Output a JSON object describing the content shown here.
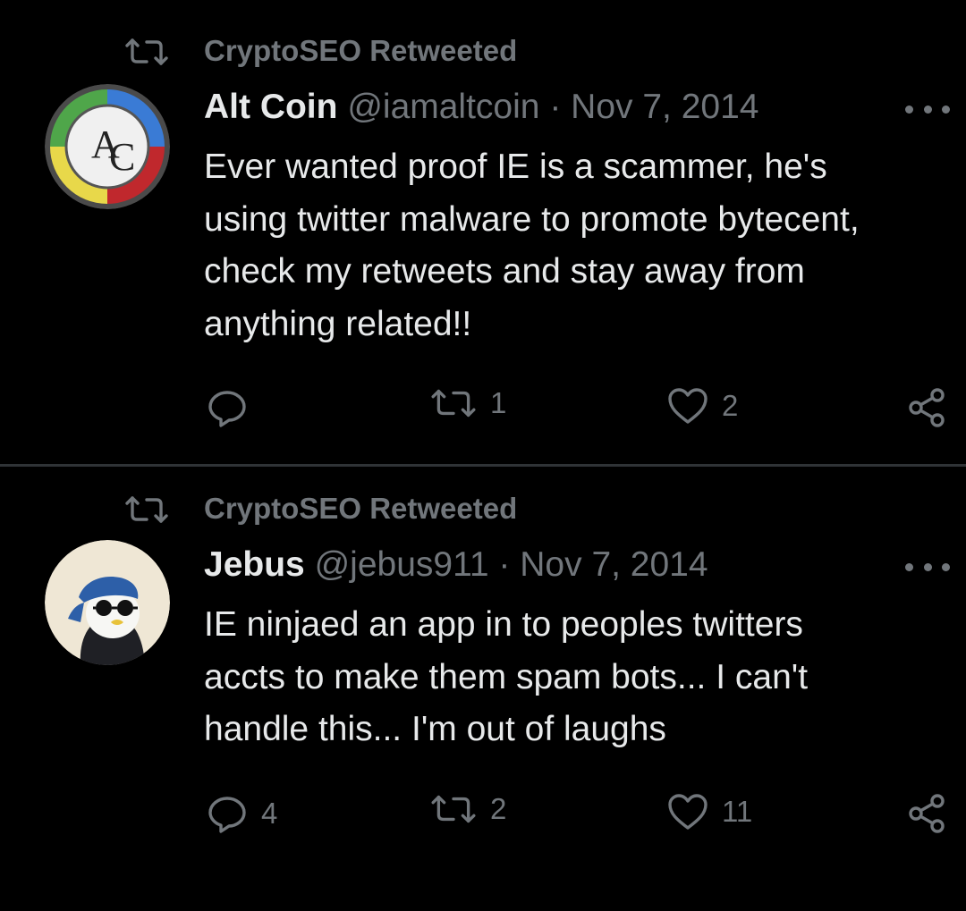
{
  "tweets": [
    {
      "retweeted_by": "CryptoSEO Retweeted",
      "name": "Alt Coin",
      "handle": "@iamaltcoin",
      "separator": "·",
      "date": "Nov 7, 2014",
      "text": "Ever wanted proof IE is a scammer, he's\nusing twitter malware to promote bytecent,\ncheck my retweets and stay away from\nanything related!!",
      "avatar_initials": "AC",
      "replies": "",
      "retweets": "1",
      "likes": "2"
    },
    {
      "retweeted_by": "CryptoSEO Retweeted",
      "name": "Jebus",
      "handle": "@jebus911",
      "separator": "·",
      "date": "Nov 7, 2014",
      "text": "IE ninjaed an app in to peoples twitters\naccts to make them spam bots... I can't\nhandle this... I'm out of laughs",
      "replies": "4",
      "retweets": "2",
      "likes": "11"
    }
  ],
  "colors": {
    "background": "#000000",
    "text_primary": "#e7e9ea",
    "text_secondary": "#71767b",
    "divider": "#2f3336"
  },
  "icons": [
    "retweet-icon",
    "reply-icon",
    "like-icon",
    "share-icon",
    "more-icon"
  ]
}
